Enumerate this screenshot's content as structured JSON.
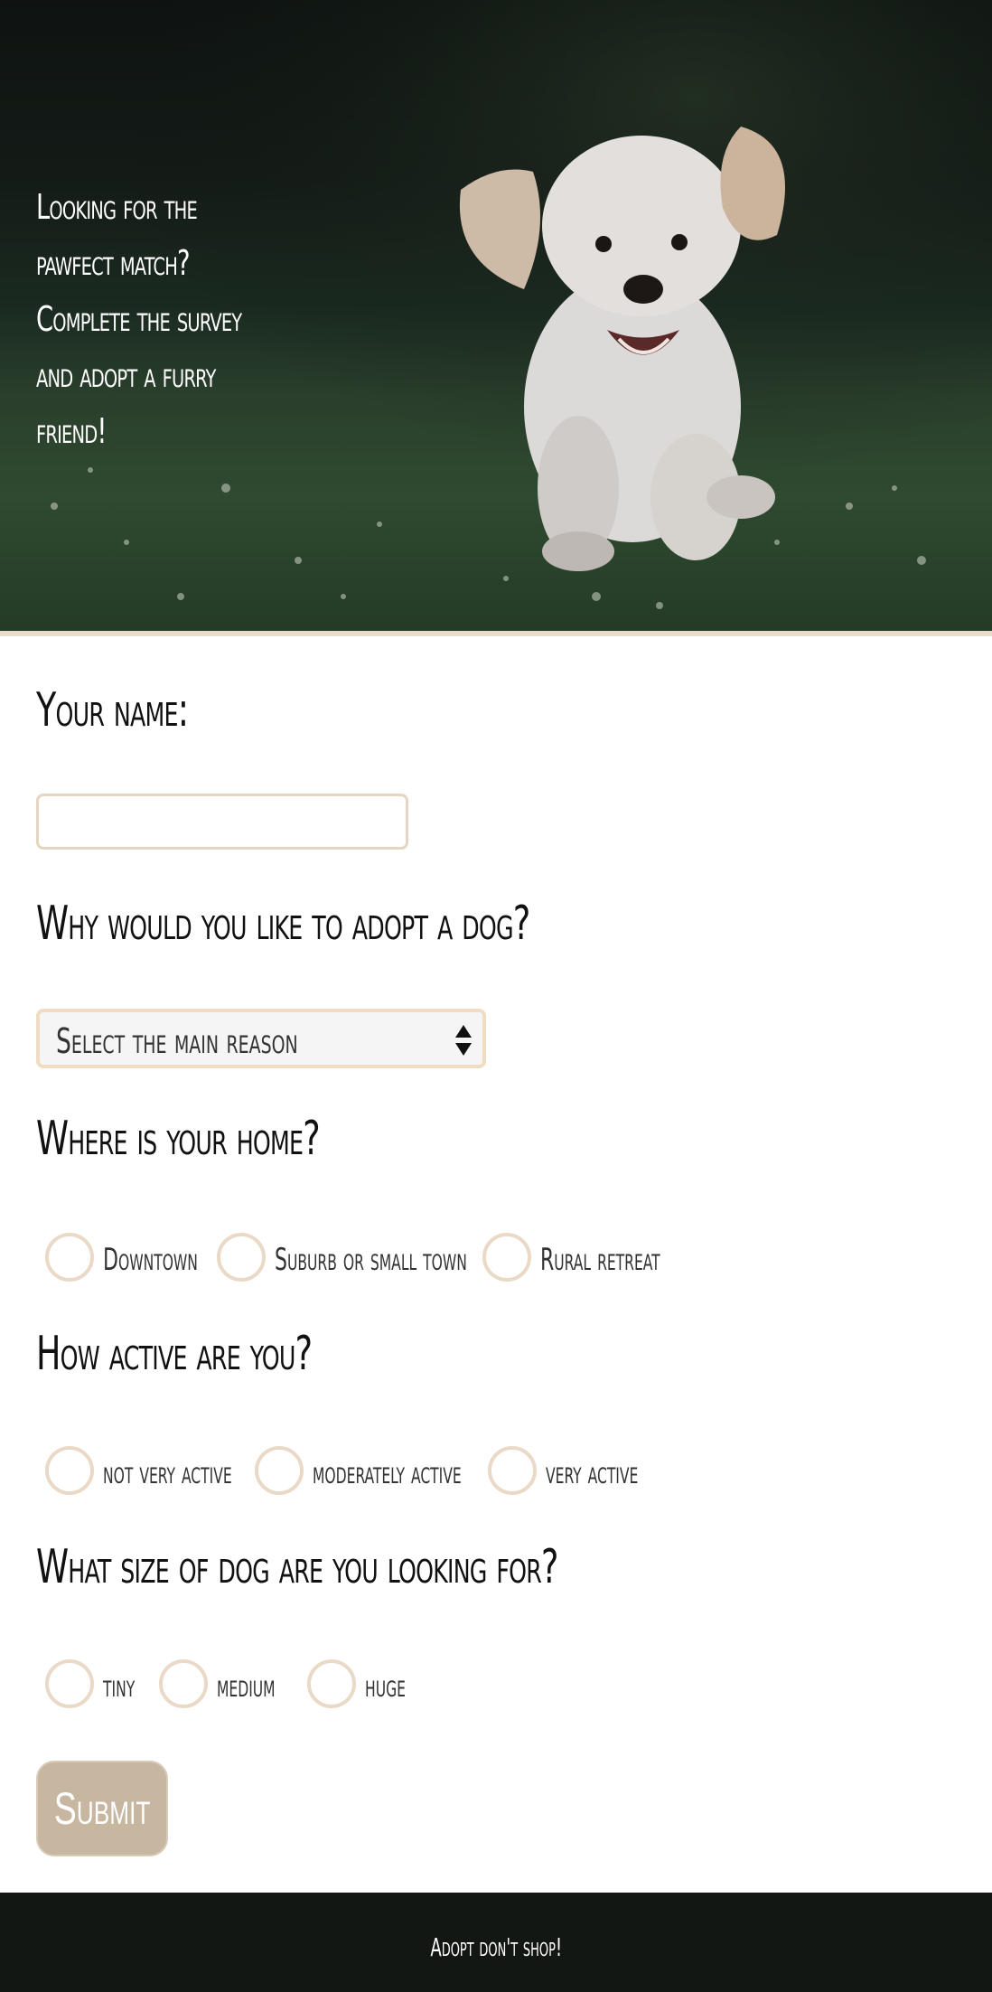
{
  "hero": {
    "tagline": "Looking for the pawfect match? Complete the survey and adopt a furry friend!"
  },
  "form": {
    "name_label": "Your name:",
    "name_value": "",
    "reason_label": "Why would you like to adopt a dog?",
    "reason_select": {
      "selected": "Select the main reason"
    },
    "home_label": "Where is your home?",
    "home_options": [
      "Downtown",
      "Suburb or small town",
      "Rural retreat"
    ],
    "activity_label": "How active are you?",
    "activity_options": [
      "not very active",
      "moderately active",
      "very active"
    ],
    "size_label": "What size of dog are you looking for?",
    "size_options": [
      "tiny",
      "medium",
      "huge"
    ],
    "submit_label": "Submit"
  },
  "footer": {
    "text": "Adopt don't shop!"
  },
  "colors": {
    "accent_border": "#e6d5c0",
    "submit_bg": "#c7b6a0",
    "footer_bg": "#121714"
  }
}
